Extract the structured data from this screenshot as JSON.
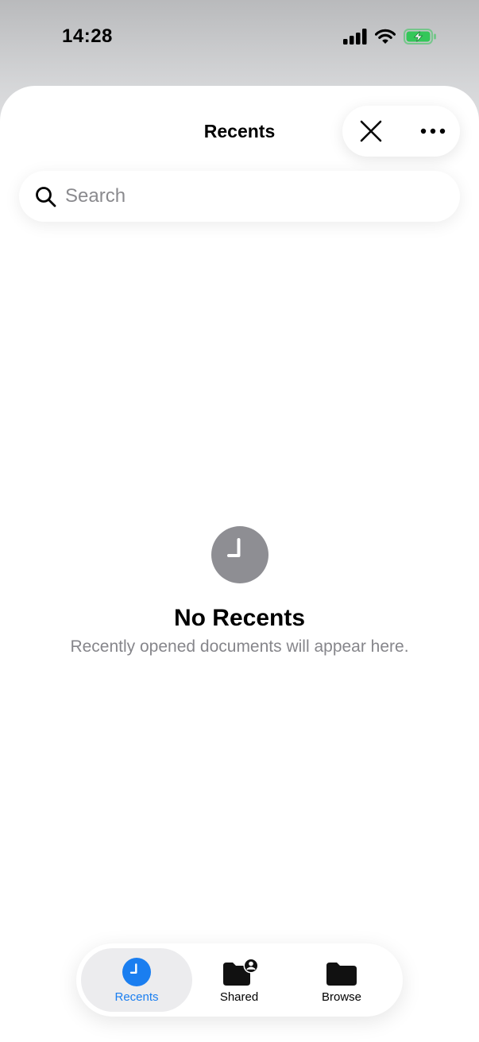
{
  "status_bar": {
    "time": "14:28",
    "signal_icon": "cellular-signal-icon",
    "wifi_icon": "wifi-icon",
    "battery_icon": "battery-charging-icon",
    "battery_color": "#34c759"
  },
  "header": {
    "title": "Recents",
    "close_icon": "close-icon",
    "more_icon": "ellipsis-icon"
  },
  "search": {
    "placeholder": "Search",
    "value": ""
  },
  "empty_state": {
    "icon": "clock-icon",
    "title": "No Recents",
    "subtitle": "Recently opened documents will appear here."
  },
  "tab_bar": {
    "accent_color": "#1a7ef0",
    "tabs": [
      {
        "label": "Recents",
        "icon": "clock-icon",
        "active": true
      },
      {
        "label": "Shared",
        "icon": "shared-folder-icon",
        "active": false
      },
      {
        "label": "Browse",
        "icon": "folder-icon",
        "active": false
      }
    ]
  }
}
